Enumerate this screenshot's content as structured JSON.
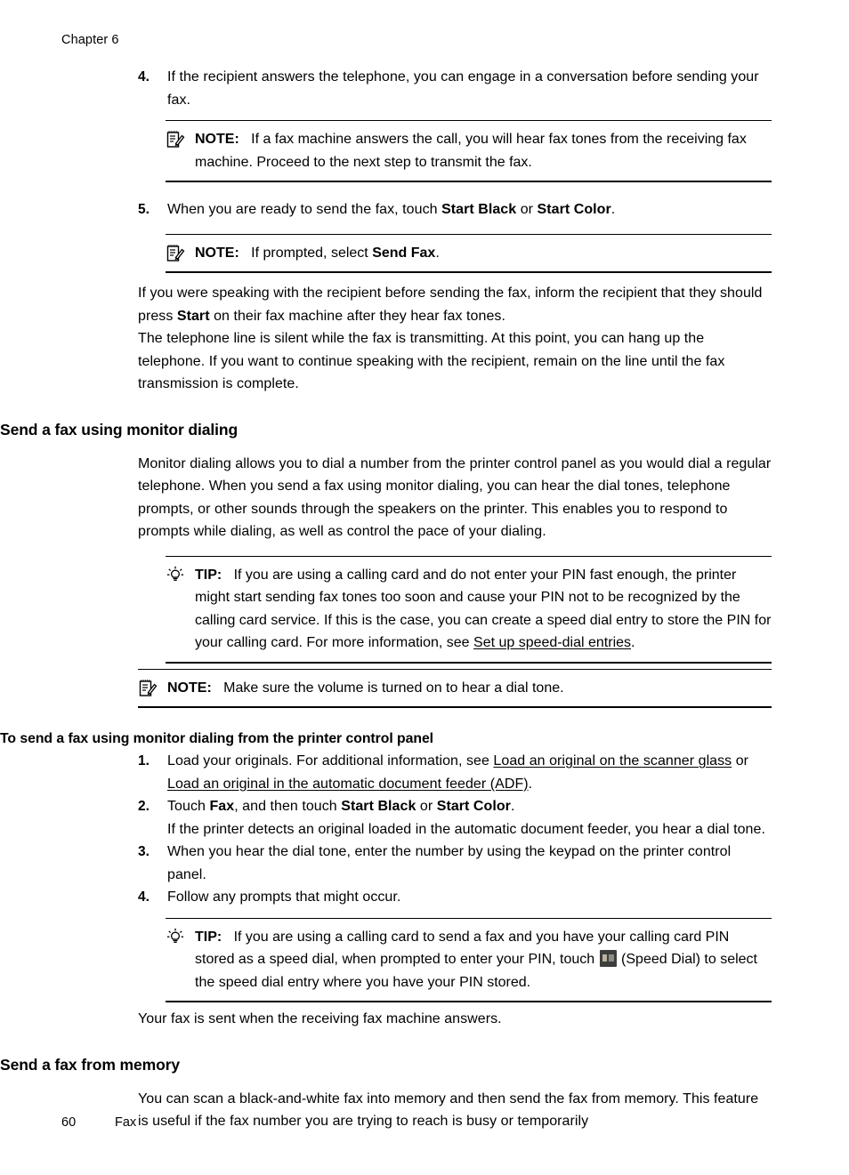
{
  "page": {
    "running_head": "Chapter 6",
    "footer_page_number": "60",
    "footer_section": "Fax"
  },
  "steps_top": [
    {
      "number": "4.",
      "text": "If the recipient answers the telephone, you can engage in a conversation before sending your fax."
    },
    {
      "number": "5.",
      "prefix": "When you are ready to send the fax, touch ",
      "bold1": "Start Black",
      "mid": " or ",
      "bold2": "Start Color",
      "suffix": "."
    }
  ],
  "note_after_step4": {
    "icon": "note-icon",
    "label": "NOTE:",
    "text": "If a fax machine answers the call, you will hear fax tones from the receiving fax machine. Proceed to the next step to transmit the fax."
  },
  "note_after_step5": {
    "icon": "note-icon",
    "label": "NOTE:",
    "prefix": "If prompted, select ",
    "bold": "Send Fax",
    "suffix": "."
  },
  "after_note_paragraphs": {
    "p1_prefix": "If you were speaking with the recipient before sending the fax, inform the recipient that they should press ",
    "p1_bold": "Start",
    "p1_suffix": " on their fax machine after they hear fax tones.",
    "p2": "The telephone line is silent while the fax is transmitting. At this point, you can hang up the telephone. If you want to continue speaking with the recipient, remain on the line until the fax transmission is complete."
  },
  "section_monitor_dialing": {
    "heading": "Send a fax using monitor dialing",
    "intro": "Monitor dialing allows you to dial a number from the printer control panel as you would dial a regular telephone. When you send a fax using monitor dialing, you can hear the dial tones, telephone prompts, or other sounds through the speakers on the printer. This enables you to respond to prompts while dialing, as well as control the pace of your dialing.",
    "tip": {
      "icon": "tip-lightbulb-icon",
      "label": "TIP:",
      "prefix": "If you are using a calling card and do not enter your PIN fast enough, the printer might start sending fax tones too soon and cause your PIN not to be recognized by the calling card service. If this is the case, you can create a speed dial entry to store the PIN for your calling card. For more information, see ",
      "link": "Set up speed-dial entries",
      "suffix": "."
    },
    "note": {
      "icon": "note-icon",
      "label": "NOTE:",
      "text": "Make sure the volume is turned on to hear a dial tone."
    },
    "procedure_heading": "To send a fax using monitor dialing from the printer control panel",
    "procedure_steps": [
      {
        "number": "1.",
        "prefix": "Load your originals. For additional information, see ",
        "link1": "Load an original on the scanner glass",
        "mid": " or ",
        "link2": "Load an original in the automatic document feeder (ADF)",
        "suffix": "."
      },
      {
        "number": "2.",
        "prefix": "Touch ",
        "bold1": "Fax",
        "mid": ", and then touch ",
        "bold2": "Start Black",
        "mid2": " or ",
        "bold3": "Start Color",
        "suffix": ".",
        "continuation": "If the printer detects an original loaded in the automatic document feeder, you hear a dial tone."
      },
      {
        "number": "3.",
        "text": "When you hear the dial tone, enter the number by using the keypad on the printer control panel."
      },
      {
        "number": "4.",
        "text": "Follow any prompts that might occur."
      }
    ],
    "tip_speed_dial": {
      "icon": "tip-lightbulb-icon",
      "label": "TIP:",
      "prefix": "If you are using a calling card to send a fax and you have your calling card PIN stored as a speed dial, when prompted to enter your PIN, touch ",
      "inline_icon": "speed-dial-icon",
      "suffix": " (Speed Dial) to select the speed dial entry where you have your PIN stored."
    },
    "closing": "Your fax is sent when the receiving fax machine answers."
  },
  "section_from_memory": {
    "heading": "Send a fax from memory",
    "text": "You can scan a black-and-white fax into memory and then send the fax from memory. This feature is useful if the fax number you are trying to reach is busy or temporarily"
  }
}
